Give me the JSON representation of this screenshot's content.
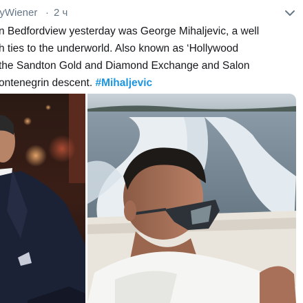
{
  "header": {
    "author_name": "lyWiener",
    "separator": "·",
    "timestamp": "2 ч",
    "more_icon": "chevron-down-icon"
  },
  "tweet": {
    "lines": [
      "n Bedfordview yesterday was George Mihaljevic, a well",
      "h ties to the underworld. Also known as ‘Hollywood",
      "the Sandton Gold and Diamond Exchange and Salon",
      "ontenegrin descent."
    ],
    "hashtag": "#Mihaljevic"
  },
  "media": {
    "photos": [
      "photo-man-in-suit",
      "photo-man-on-boat"
    ]
  },
  "colors": {
    "text": "#14171a",
    "muted": "#657786",
    "link": "#1b95e0"
  }
}
